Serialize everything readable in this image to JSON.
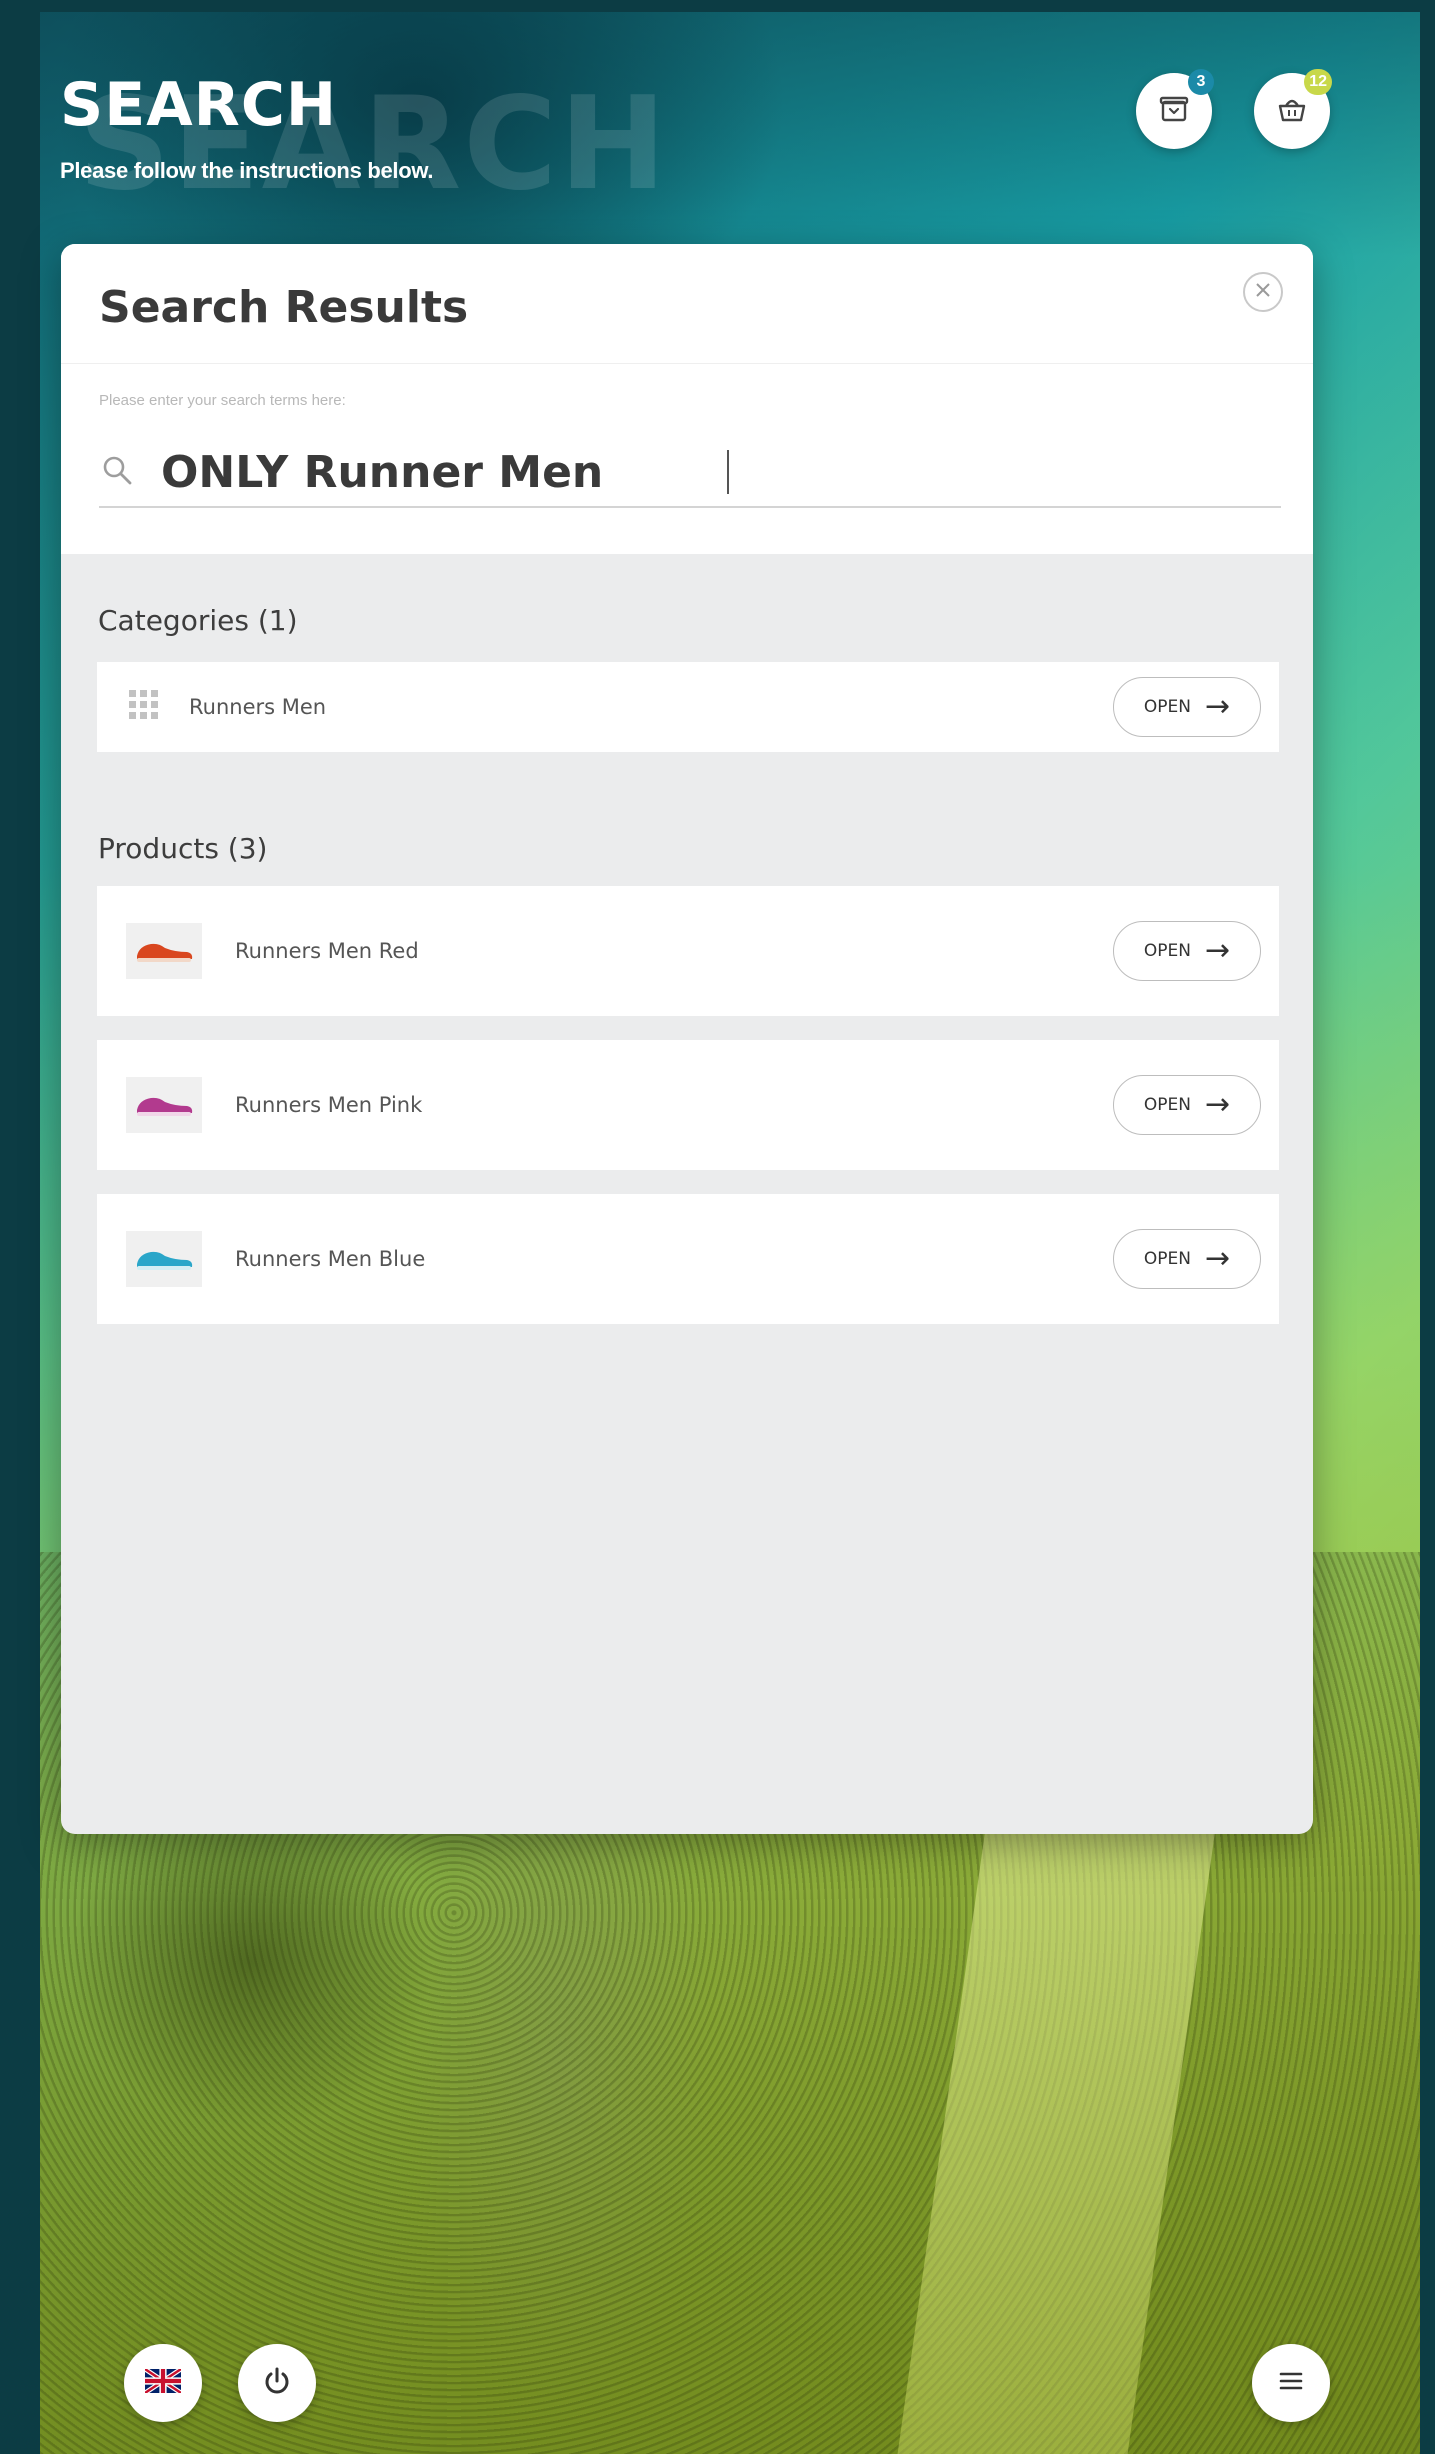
{
  "header": {
    "title": "SEARCH",
    "watermark": "SEARCH",
    "subtitle": "Please follow the instructions below."
  },
  "topbar": {
    "wishlist_count": "3",
    "wishlist_badge_color": "#1b8aa8",
    "cart_count": "12",
    "cart_badge_color": "#c8d84a"
  },
  "panel": {
    "title": "Search Results",
    "search_hint": "Please enter your search terms here:",
    "search_value": "ONLY Runner Men"
  },
  "categories": {
    "title": "Categories (1)",
    "items": [
      {
        "label": "Runners Men",
        "button": "OPEN"
      }
    ]
  },
  "products": {
    "title": "Products (3)",
    "items": [
      {
        "label": "Runners Men Red",
        "button": "OPEN",
        "color": "#d9471f"
      },
      {
        "label": "Runners Men Pink",
        "button": "OPEN",
        "color": "#b23a8e"
      },
      {
        "label": "Runners Men Blue",
        "button": "OPEN",
        "color": "#2aa6c9"
      }
    ]
  },
  "bottom": {
    "language": "en-GB",
    "power_icon": "power-icon",
    "menu_icon": "hamburger-menu-icon"
  }
}
